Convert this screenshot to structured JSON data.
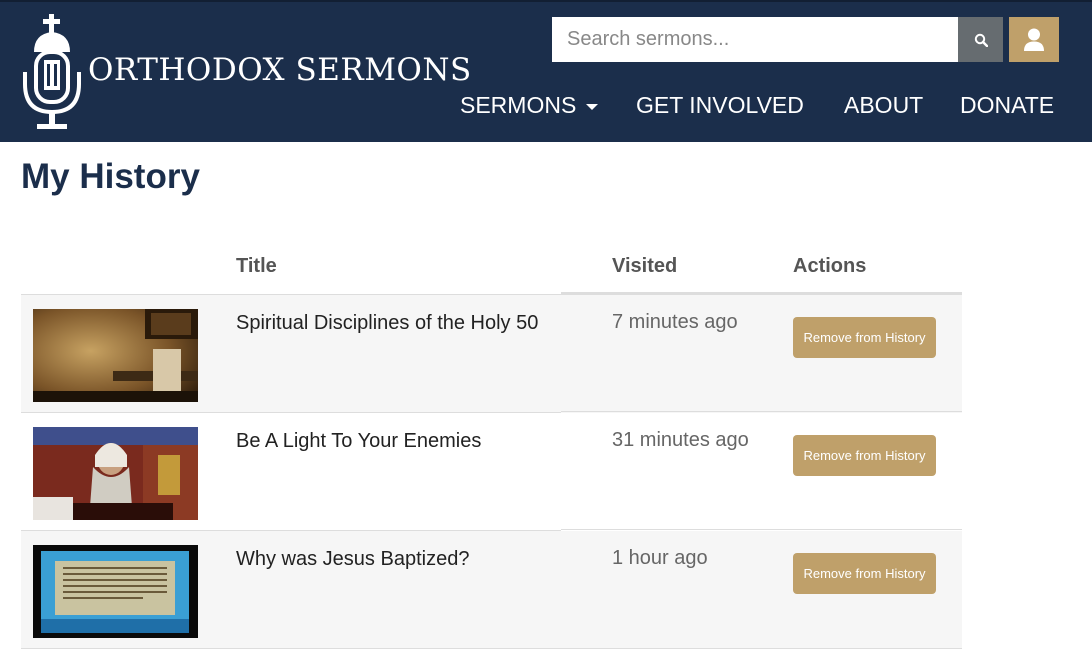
{
  "header": {
    "brand": "ORTHODOX SERMONS",
    "search_placeholder": "Search sermons...",
    "search_icon": "search-icon",
    "user_icon": "user-icon",
    "nav": [
      {
        "label": "SERMONS",
        "has_dropdown": true
      },
      {
        "label": "GET INVOLVED"
      },
      {
        "label": "ABOUT"
      },
      {
        "label": "DONATE"
      }
    ]
  },
  "page": {
    "title": "My History"
  },
  "table": {
    "columns": [
      "",
      "Title",
      "Visited",
      "Actions"
    ],
    "rows": [
      {
        "title": "Spiritual Disciplines of the Holy 50",
        "visited": "7 minutes ago",
        "action": "Remove from History"
      },
      {
        "title": "Be A Light To Your Enemies",
        "visited": "31 minutes ago",
        "action": "Remove from History"
      },
      {
        "title": "Why was Jesus Baptized?",
        "visited": "1 hour ago",
        "action": "Remove from History"
      }
    ]
  },
  "colors": {
    "header_bg": "#1b2e4b",
    "accent": "#bfa06a",
    "search_button": "#666c70"
  }
}
